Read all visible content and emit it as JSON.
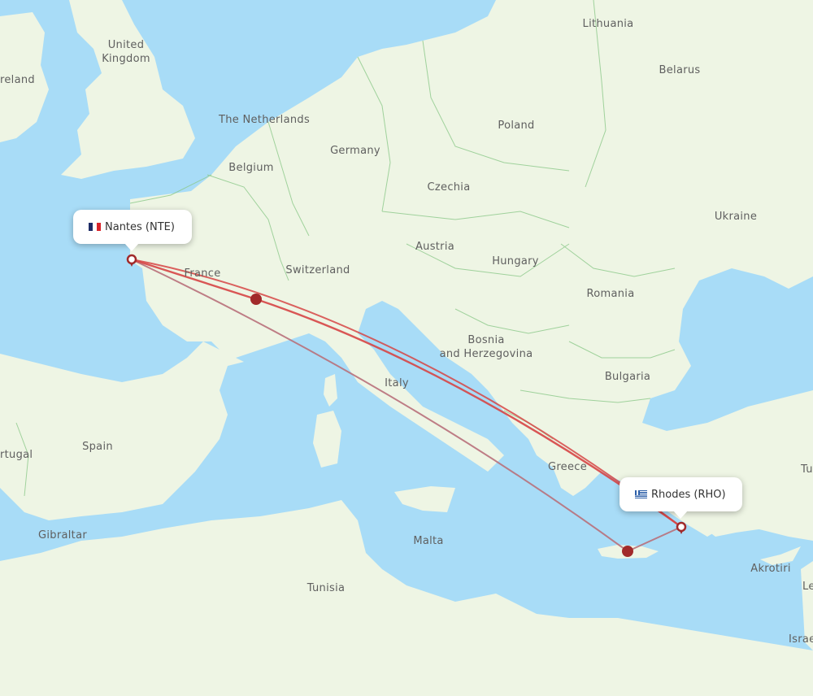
{
  "map": {
    "type": "flight-route-map",
    "colors": {
      "water": "#a8dcf7",
      "land": "#eef5e4",
      "border": "#8cc98a",
      "route_primary": "#d64545",
      "route_secondary": "#b8707a",
      "stopover": "#a12a2a",
      "airport_marker": "#a12a2a",
      "label_text": "#5f5f5f"
    },
    "country_labels": [
      {
        "id": "united-kingdom",
        "lines": [
          "United",
          "Kingdom"
        ]
      },
      {
        "id": "ireland",
        "lines": [
          "reland"
        ]
      },
      {
        "id": "the-netherlands",
        "lines": [
          "The Netherlands"
        ]
      },
      {
        "id": "belgium",
        "lines": [
          "Belgium"
        ]
      },
      {
        "id": "germany",
        "lines": [
          "Germany"
        ]
      },
      {
        "id": "france",
        "lines": [
          "France"
        ]
      },
      {
        "id": "switzerland",
        "lines": [
          "Switzerland"
        ]
      },
      {
        "id": "austria",
        "lines": [
          "Austria"
        ]
      },
      {
        "id": "czechia",
        "lines": [
          "Czechia"
        ]
      },
      {
        "id": "poland",
        "lines": [
          "Poland"
        ]
      },
      {
        "id": "lithuania",
        "lines": [
          "Lithuania"
        ]
      },
      {
        "id": "belarus",
        "lines": [
          "Belarus"
        ]
      },
      {
        "id": "ukraine",
        "lines": [
          "Ukraine"
        ]
      },
      {
        "id": "hungary",
        "lines": [
          "Hungary"
        ]
      },
      {
        "id": "romania",
        "lines": [
          "Romania"
        ]
      },
      {
        "id": "bosnia",
        "lines": [
          "Bosnia",
          "and Herzegovina"
        ]
      },
      {
        "id": "bulgaria",
        "lines": [
          "Bulgaria"
        ]
      },
      {
        "id": "italy",
        "lines": [
          "Italy"
        ]
      },
      {
        "id": "greece",
        "lines": [
          "Greece"
        ]
      },
      {
        "id": "spain",
        "lines": [
          "Spain"
        ]
      },
      {
        "id": "portugal",
        "lines": [
          "rtugal"
        ]
      },
      {
        "id": "gibraltar",
        "lines": [
          "Gibraltar"
        ]
      },
      {
        "id": "malta",
        "lines": [
          "Malta"
        ]
      },
      {
        "id": "tunisia",
        "lines": [
          "Tunisia"
        ]
      },
      {
        "id": "akrotiri",
        "lines": [
          "Akrotiri"
        ]
      },
      {
        "id": "turkey",
        "lines": [
          "Tu"
        ]
      },
      {
        "id": "lebanon",
        "lines": [
          "Le"
        ]
      },
      {
        "id": "israel",
        "lines": [
          "Israe"
        ]
      }
    ],
    "airports": {
      "origin": {
        "name": "Nantes",
        "code": "NTE",
        "label": "Nantes (NTE)",
        "flag": "france-flag"
      },
      "destination": {
        "name": "Rhodes",
        "code": "RHO",
        "label": "Rhodes (RHO)",
        "flag": "greece-flag"
      }
    },
    "routes": [
      {
        "id": "route-via-lyon",
        "from": "NTE",
        "to": "RHO",
        "style": "primary",
        "stopover": "lyon-area"
      },
      {
        "id": "route-direct",
        "from": "NTE",
        "to": "RHO",
        "style": "primary"
      },
      {
        "id": "route-via-crete",
        "from": "NTE",
        "to": "RHO",
        "style": "secondary",
        "stopover": "crete-area"
      }
    ]
  }
}
